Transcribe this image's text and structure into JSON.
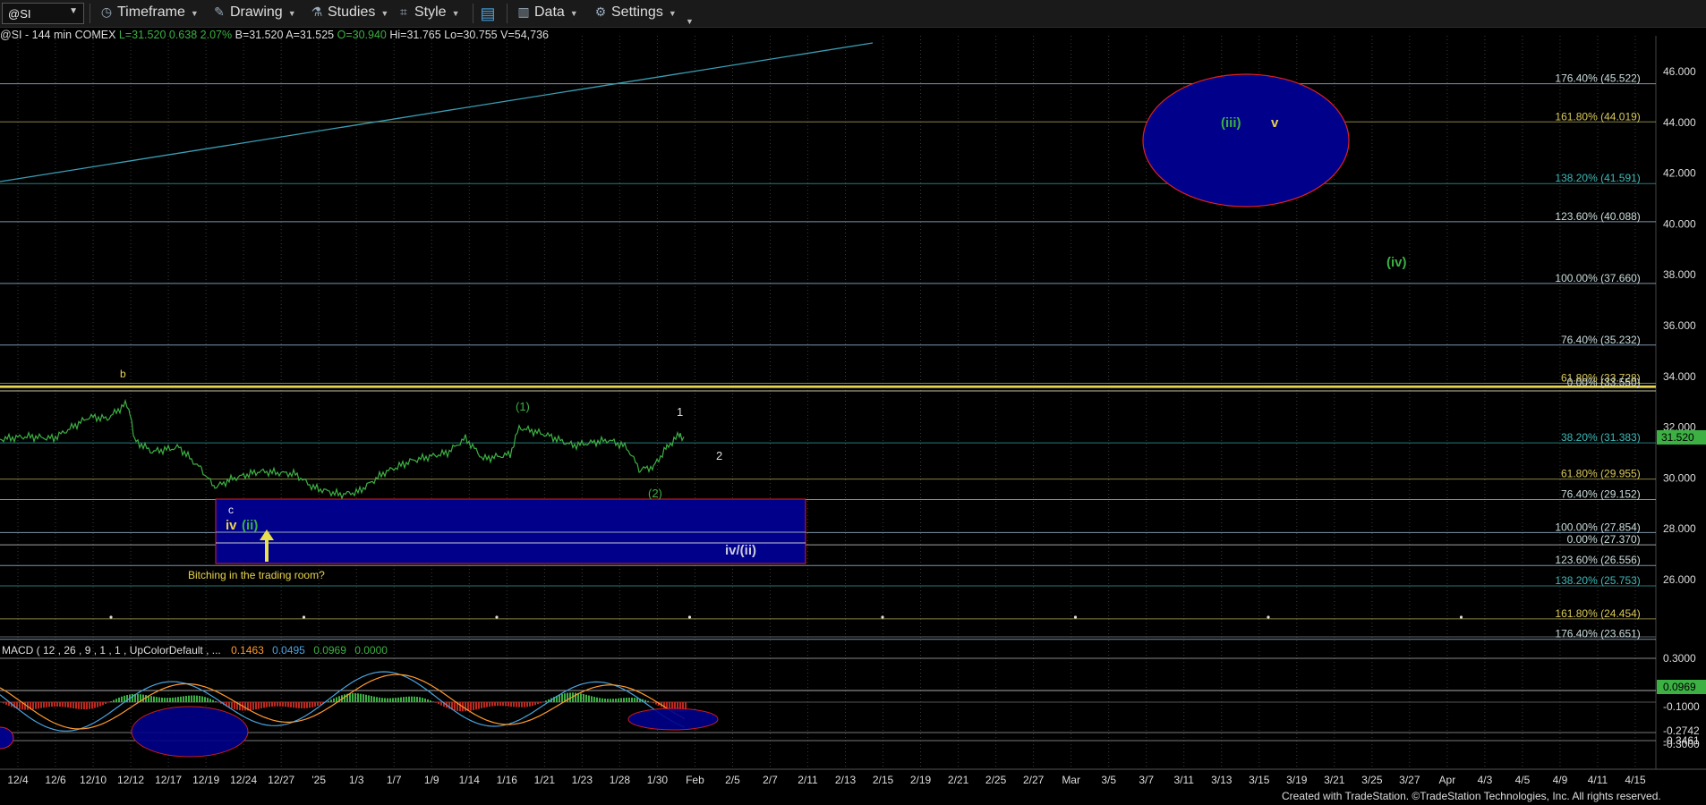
{
  "toolbar": {
    "symbol": "@SI",
    "timeframe": "Timeframe",
    "drawing": "Drawing",
    "studies": "Studies",
    "style": "Style",
    "data": "Data",
    "settings": "Settings"
  },
  "header": {
    "symbol": "@SI",
    "interval": "- 144 min",
    "exchange": "COMEX",
    "last": "L=31.520",
    "change": "0.638",
    "change_pct": "2.07%",
    "bid": "B=31.520",
    "ask": "A=31.525",
    "open": "O=30.940",
    "high": "Hi=31.765",
    "low": "Lo=30.755",
    "volume": "V=54,736"
  },
  "colors": {
    "background": "#000000",
    "price_line": "#3cb043",
    "fib_line": "#8fb0c8",
    "box_fill": "#00008b",
    "box_border": "#e02020",
    "label_yellow": "#e8d44d",
    "label_green": "#3cb043",
    "up_histogram": "#3cb043",
    "down_histogram": "#c0281e",
    "macd_line": "#4aa3df",
    "signal_line": "#ff9a2e",
    "trendline": "#3a9fb5"
  },
  "price_axis": {
    "ticks": [
      "46.000",
      "44.000",
      "42.000",
      "40.000",
      "38.000",
      "36.000",
      "34.000",
      "32.000",
      "30.000",
      "28.000",
      "26.000"
    ],
    "last_price_tag": "31.520"
  },
  "fib_levels": [
    {
      "label": "176.40% (45.522)",
      "value": 45.522
    },
    {
      "label": "161.80% (44.019)",
      "value": 44.019
    },
    {
      "label": "138.20% (41.591)",
      "value": 41.591
    },
    {
      "label": "123.60% (40.088)",
      "value": 40.088
    },
    {
      "label": "100.00% (37.660)",
      "value": 37.66
    },
    {
      "label": "76.40% (35.232)",
      "value": 35.232
    },
    {
      "label": "61.80% (33.728)",
      "value": 33.728
    },
    {
      "label": "0.00% (33.550)",
      "value": 33.55
    },
    {
      "label": "38.20% (31.383)",
      "value": 31.383
    },
    {
      "label": "61.80% (29.955)",
      "value": 29.955
    },
    {
      "label": "76.40% (29.152)",
      "value": 29.152
    },
    {
      "label": "100.00% (27.854)",
      "value": 27.854
    },
    {
      "label": "0.00% (27.370)",
      "value": 27.37
    },
    {
      "label": "123.60% (26.556)",
      "value": 26.556
    },
    {
      "label": "138.20% (25.753)",
      "value": 25.753
    },
    {
      "label": "161.80% (24.454)",
      "value": 24.454
    },
    {
      "label": "176.40% (23.651)",
      "value": 23.651
    }
  ],
  "wave_labels": {
    "b": "b",
    "c": "c",
    "iv": "iv",
    "ii": "(ii)",
    "w1": "(1)",
    "w2": "(2)",
    "one": "1",
    "two": "2",
    "iii": "(iii)",
    "v": "v",
    "wiv": "(iv)",
    "iv_ii": "iv/(ii)"
  },
  "annotation": "Bitching in the trading room?",
  "macd": {
    "title": "MACD ( 12 , 26 , 9 , 1 , 1 , UpColorDefault , ...",
    "v1": "0.1463",
    "v2": "0.0495",
    "v3": "0.0969",
    "v4": "0.0000",
    "axis_ticks": [
      "0.3000",
      "0.0528",
      "-0.1000",
      "-0.2742",
      "-0.3461",
      "-0.3000"
    ],
    "tag": "0.0969"
  },
  "date_axis": [
    "12/4",
    "12/6",
    "12/10",
    "12/12",
    "12/17",
    "12/19",
    "12/24",
    "12/27",
    "'25",
    "1/3",
    "1/7",
    "1/9",
    "1/14",
    "1/16",
    "1/21",
    "1/23",
    "1/28",
    "1/30",
    "Feb",
    "2/5",
    "2/7",
    "2/11",
    "2/13",
    "2/15",
    "2/19",
    "2/21",
    "2/25",
    "2/27",
    "Mar",
    "3/5",
    "3/7",
    "3/11",
    "3/13",
    "3/15",
    "3/19",
    "3/21",
    "3/25",
    "3/27",
    "Apr",
    "4/3",
    "4/5",
    "4/9",
    "4/11",
    "4/15"
  ],
  "footer": "Created with TradeStation. ©TradeStation Technologies, Inc. All rights reserved."
}
